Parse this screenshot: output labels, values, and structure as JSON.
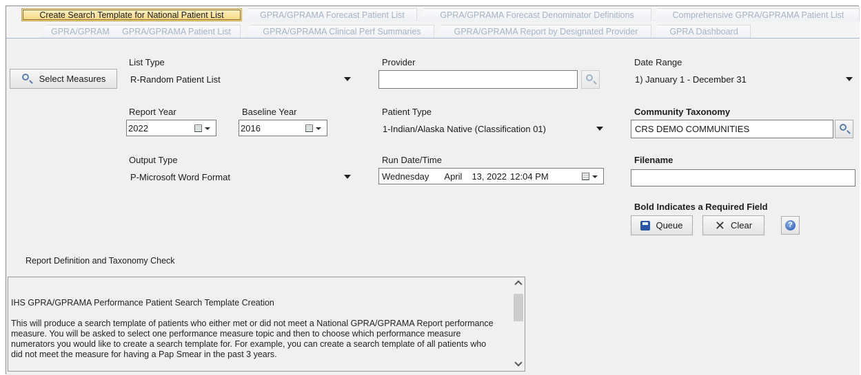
{
  "tabs_row1": [
    {
      "label": "Create Search Template for National Patient List",
      "active": true
    },
    {
      "label": "GPRA/GPRAMA Forecast Patient List",
      "active": false
    },
    {
      "label": "GPRA/GPRAMA Forecast Denominator Definitions",
      "active": false
    },
    {
      "label": "Comprehensive GPRA/GPRAMA Patient List",
      "active": false
    }
  ],
  "tabs_row2": [
    {
      "label": "GPRA/GPRAMA"
    },
    {
      "label": "GPRA/GPRAMA Patient List"
    },
    {
      "label": "GPRA/GPRAMA Clinical Perf Summaries"
    },
    {
      "label": "GPRA/GPRAMA Report by Designated Provider"
    },
    {
      "label": "GPRA Dashboard"
    }
  ],
  "form": {
    "select_measures_label": "Select Measures",
    "list_type_label": "List Type",
    "list_type_value": "R-Random Patient List",
    "provider_label": "Provider",
    "provider_value": "",
    "date_range_label": "Date Range",
    "date_range_value": "1) January 1 - December 31",
    "report_year_label": "Report Year",
    "report_year_value": "2022",
    "baseline_year_label": "Baseline Year",
    "baseline_year_value": "2016",
    "patient_type_label": "Patient Type",
    "patient_type_value": "1-Indian/Alaska Native (Classification 01)",
    "community_taxonomy_label": "Community Taxonomy",
    "community_taxonomy_value": "CRS DEMO COMMUNITIES",
    "output_type_label": "Output Type",
    "output_type_value": "P-Microsoft Word Format",
    "run_datetime_label": "Run Date/Time",
    "run_day": "Wednesday",
    "run_month": "April",
    "run_date": "13, 2022",
    "run_time": "12:04 PM",
    "filename_label": "Filename",
    "filename_value": "",
    "required_note": "Bold Indicates a Required Field",
    "queue_label": "Queue",
    "clear_label": "Clear"
  },
  "report": {
    "section_label": "Report Definition and Taxonomy Check",
    "heading": "IHS GPRA/GPRAMA Performance Patient Search Template Creation",
    "body": "This will produce a search template of patients who either met or did not meet a National GPRA/GPRAMA Report performance measure.  You will be asked to select one performance measure topic and then to choose which performance measure numerators you would like to create a search template for.  For example, you can create a search template of all patients who did not meet the measure for having a Pap Smear in the past 3 years."
  },
  "icons": {
    "search": "magnifier-icon",
    "save": "floppy-disk-icon",
    "clear": "x-icon",
    "help": "help-icon",
    "calendar": "calendar-icon"
  },
  "colors": {
    "active_tab": "#f7d57f",
    "inactive_tab_text": "#a6b3c3",
    "panel_bg": "#f0f0f0"
  }
}
